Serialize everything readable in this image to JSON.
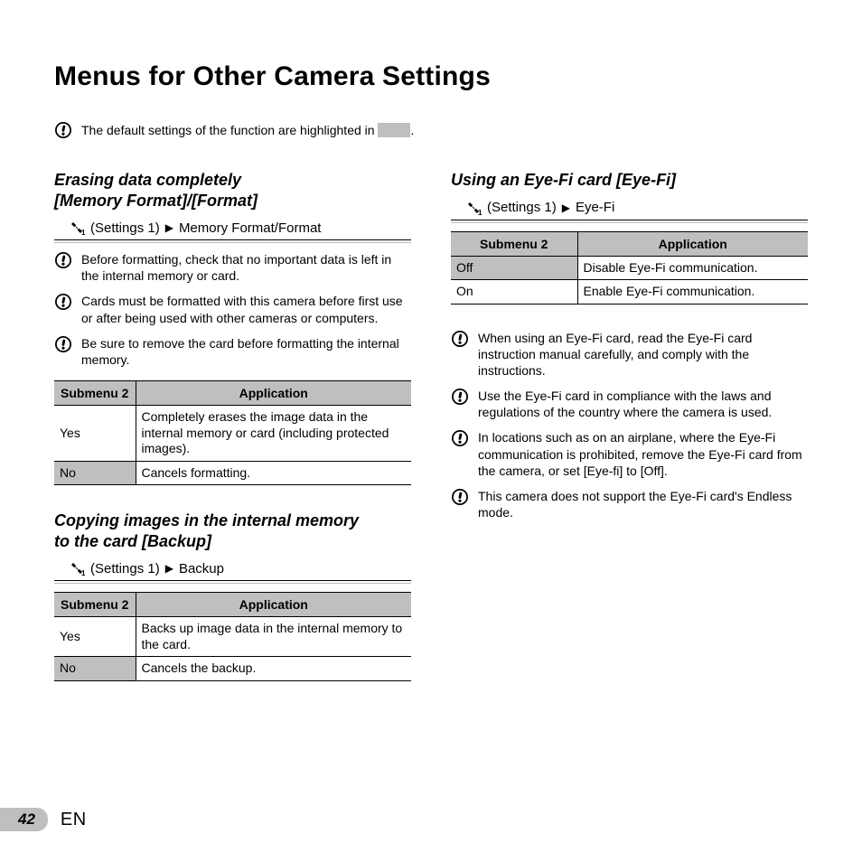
{
  "page_title": "Menus for Other Camera Settings",
  "top_note_prefix": "The default settings of the function are highlighted in ",
  "top_note_suffix": ".",
  "sections": {
    "erase": {
      "title_line1": "Erasing data completely",
      "title_line2": "[Memory Format]/[Format]",
      "crumb_group": "(Settings 1)",
      "crumb_item": "Memory Format/Format",
      "notes": [
        "Before formatting, check that no important data is left in the internal memory or card.",
        "Cards must be formatted with this camera before first use or after being used with other cameras or computers.",
        "Be sure to remove the card before formatting the internal memory."
      ],
      "table": {
        "h1": "Submenu 2",
        "h2": "Application",
        "rows": [
          {
            "key": "Yes",
            "app": "Completely erases the image data in the internal memory or card (including protected images).",
            "default": false
          },
          {
            "key": "No",
            "app": "Cancels formatting.",
            "default": true
          }
        ]
      }
    },
    "backup": {
      "title_line1": "Copying images in the internal memory",
      "title_line2": "to the card [Backup]",
      "crumb_group": "(Settings 1)",
      "crumb_item": "Backup",
      "table": {
        "h1": "Submenu 2",
        "h2": "Application",
        "rows": [
          {
            "key": "Yes",
            "app": "Backs up image data in the internal memory to the card.",
            "default": false
          },
          {
            "key": "No",
            "app": "Cancels the backup.",
            "default": true
          }
        ]
      }
    },
    "eyefi": {
      "title": "Using an Eye-Fi card [Eye-Fi]",
      "crumb_group": "(Settings 1)",
      "crumb_item": "Eye-Fi",
      "table": {
        "h1": "Submenu 2",
        "h2": "Application",
        "rows": [
          {
            "key": "Off",
            "app": "Disable Eye-Fi communication.",
            "default": true
          },
          {
            "key": "On",
            "app": "Enable Eye-Fi communication.",
            "default": false
          }
        ]
      },
      "notes": [
        "When using an Eye-Fi card, read the Eye-Fi card instruction manual carefully, and comply with the instructions.",
        "Use the Eye-Fi card in compliance with the laws and regulations of the country where the camera is used.",
        "In locations such as on an airplane, where the Eye-Fi communication is prohibited, remove the Eye-Fi card from the camera, or set [Eye-fi] to [Off].",
        "This camera does not support the Eye-Fi card's Endless mode."
      ]
    }
  },
  "footer": {
    "page_number": "42",
    "lang": "EN"
  },
  "glyphs": {
    "triangle_right": "▶"
  }
}
